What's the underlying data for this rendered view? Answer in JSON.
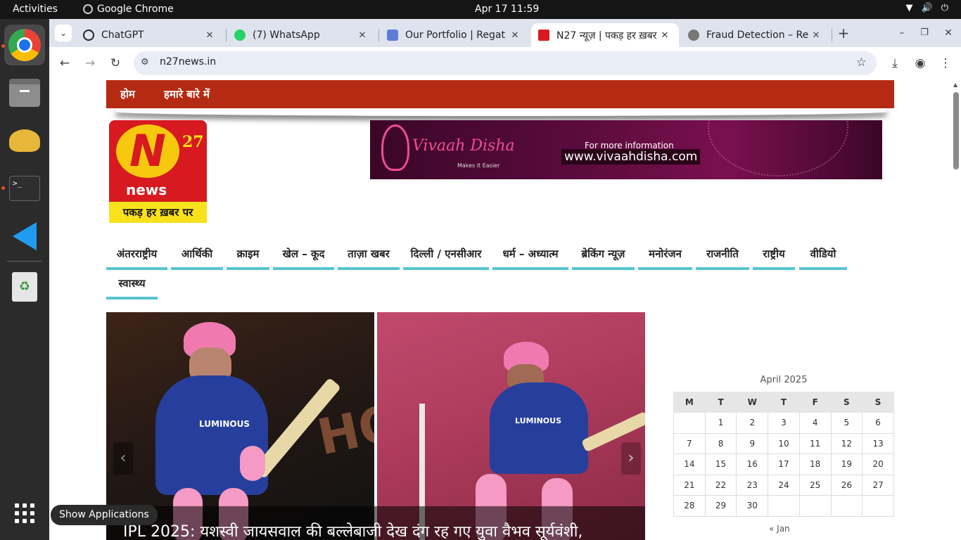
{
  "topbar": {
    "activities": "Activities",
    "app_name": "Google Chrome",
    "clock": "Apr 17  11:59"
  },
  "dock": {
    "items": [
      "Google Chrome",
      "Files",
      "Teapot App",
      "Terminal",
      "Visual Studio Code",
      "Trash",
      "Show Applications"
    ],
    "tooltip": "Show Applications"
  },
  "browser": {
    "tabs": [
      {
        "title": "ChatGPT",
        "close": "✕"
      },
      {
        "title": "(7) WhatsApp",
        "close": "✕"
      },
      {
        "title": "Our Portfolio | Regat",
        "close": "✕"
      },
      {
        "title": "N27 न्यूज़ | पकड़ हर ख़बर",
        "close": "✕"
      },
      {
        "title": "Fraud Detection – Re",
        "close": "✕"
      }
    ],
    "new_tab": "+",
    "url": "n27news.in",
    "window_controls": {
      "minimize": "–",
      "restore": "❐",
      "close": "✕"
    }
  },
  "site": {
    "top_menu": [
      "होम",
      "हमारे बारे में"
    ],
    "logo": {
      "number": "27",
      "word": "news",
      "tagline": "पकड़ हर ख़बर पर"
    },
    "banner": {
      "brand": "Vivaah Disha",
      "tagline": "Makes it Easier",
      "info": "For more information",
      "website": "www.vivaahdisha.com"
    },
    "categories": [
      "अंतरराष्ट्रीय",
      "आर्थिकी",
      "क्राइम",
      "खेल – कूद",
      "ताज़ा खबर",
      "दिल्ली / एनसीआर",
      "धर्म – अध्यात्म",
      "ब्रेकिंग न्यूज़",
      "मनोरंजन",
      "राजनीति",
      "राष्ट्रीय",
      "वीडियो",
      "स्वास्थ्य"
    ],
    "hero": {
      "headline": "IPL 2025: यशस्वी जायसवाल की बल्लेबाजी देख दंग रह गए युवा वैभव सूर्यवंशी,",
      "jersey_text_left": "LUMINOUS",
      "jersey_text_right": "LUMINOUS",
      "bg_text": "HON"
    },
    "calendar": {
      "caption": "April 2025",
      "days": [
        "M",
        "T",
        "W",
        "T",
        "F",
        "S",
        "S"
      ],
      "weeks": [
        [
          "",
          "1",
          "2",
          "3",
          "4",
          "5",
          "6"
        ],
        [
          "7",
          "8",
          "9",
          "10",
          "11",
          "12",
          "13"
        ],
        [
          "14",
          "15",
          "16",
          "17",
          "18",
          "19",
          "20"
        ],
        [
          "21",
          "22",
          "23",
          "24",
          "25",
          "26",
          "27"
        ],
        [
          "28",
          "29",
          "30",
          "",
          "",
          "",
          ""
        ]
      ],
      "prev": "« Jan"
    }
  },
  "colors": {
    "menu_red": "#b52a12",
    "cat_underline": "#57c4d0",
    "tab_strip": "#dfe3ee"
  }
}
